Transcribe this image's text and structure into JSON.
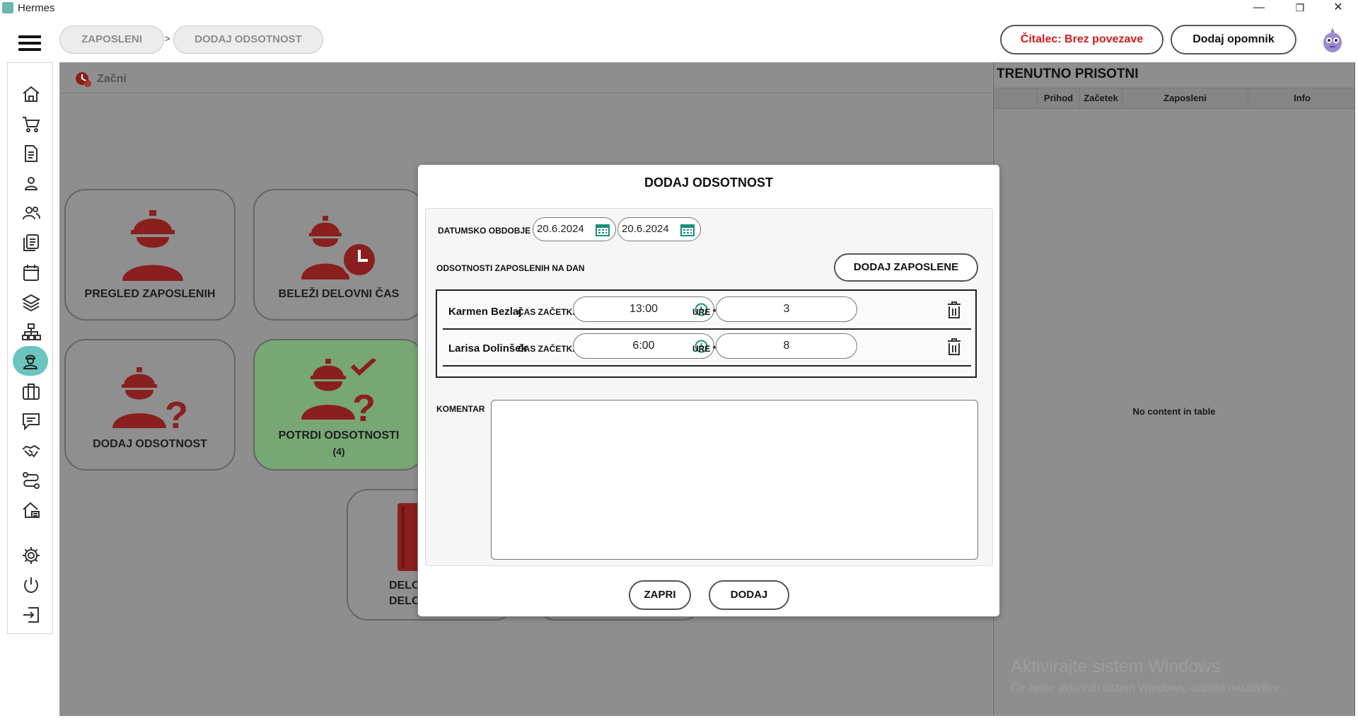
{
  "window": {
    "title": "Hermes",
    "controls": {
      "minimize": "—",
      "restore": "❐",
      "close": "✕"
    }
  },
  "breadcrumb": [
    "ZAPOSLENI",
    "DODAJ ODSOTNOST"
  ],
  "breadcrumb_separator": ">",
  "topbar": {
    "reader_status": "Čitalec: Brez povezave",
    "reader_status_color": "#d81b1b",
    "add_reminder": "Dodaj opomnik"
  },
  "sidebar": {
    "icons": [
      "home-icon",
      "cart-icon",
      "document-icon",
      "person-icon",
      "people-icon",
      "list-icon",
      "calendar-icon",
      "layers-icon",
      "hierarchy-icon",
      "employee-icon",
      "briefcase-icon",
      "chat-icon",
      "handshake-icon",
      "route-icon",
      "house-icon",
      "settings-icon",
      "power-icon",
      "logout-icon"
    ],
    "active": "employee-icon",
    "active_color": "#6cc4bf"
  },
  "main": {
    "start_label": "Začni",
    "tiles": [
      {
        "label": "PREGLED ZAPOSLENIH",
        "icon": "worker-icon"
      },
      {
        "label": "BELEŽI DELOVNI ČAS",
        "icon": "worker-clock-icon"
      },
      {
        "label": "DODAJ ODSOTNOST",
        "icon": "worker-question-icon"
      },
      {
        "label": "POTRDI ODSOTNOSTI",
        "label2": "(4)",
        "icon": "worker-check-icon",
        "highlight": true
      },
      {
        "label": "DELO",
        "label2": "DELO",
        "icon": "book-icon"
      }
    ],
    "icon_color": "#8a1f1f",
    "highlight_color": "#77a774"
  },
  "right_panel": {
    "title": "TRENUTNO PRISOTNI",
    "columns": [
      "",
      "Prihod",
      "Začetek",
      "Zaposleni",
      "Info"
    ],
    "empty_text": "No content in table",
    "watermark_title": "Aktivirajte sistem Windows",
    "watermark_sub": "Če želite aktivirati sistem Windows, odprite nastavitve."
  },
  "modal": {
    "title": "DODAJ ODSOTNOST",
    "date_range_label": "DATUMSKO OBDOBJE",
    "date_from": "20.6.2024",
    "date_to": "20.6.2024",
    "absences_label": "ODSOTNOSTI ZAPOSLENIH NA DAN",
    "add_employees_button": "DODAJ ZAPOSLENE",
    "start_time_label": "ČAS ZAČETKA *",
    "hours_label": "URE *",
    "employees": [
      {
        "name": "Karmen Bezlaj",
        "start": "13:00",
        "hours": "3"
      },
      {
        "name": "Larisa Dolinšek",
        "start": "6:00",
        "hours": "8"
      }
    ],
    "comment_label": "KOMENTAR",
    "comment_value": "",
    "close_button": "ZAPRI",
    "add_button": "DODAJ",
    "accent_color": "#1a8f7a"
  }
}
